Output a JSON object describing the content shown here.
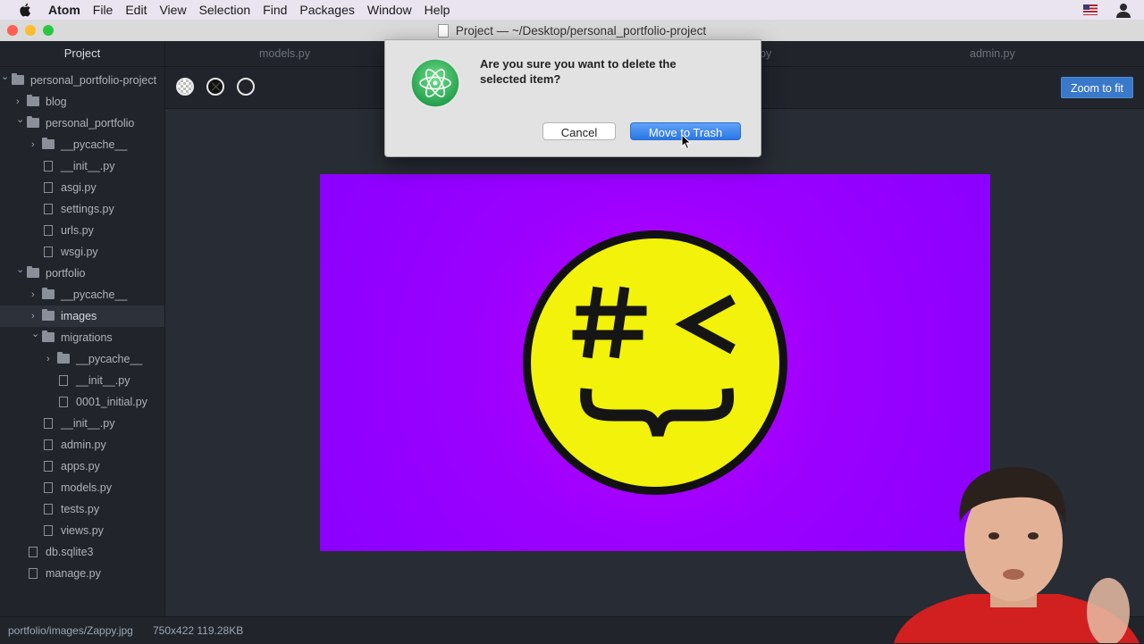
{
  "menubar": {
    "app": "Atom",
    "items": [
      "File",
      "Edit",
      "View",
      "Selection",
      "Find",
      "Packages",
      "Window",
      "Help"
    ]
  },
  "window": {
    "title": "Project — ~/Desktop/personal_portfolio-project"
  },
  "sidebar": {
    "header": "Project",
    "tree": [
      {
        "label": "personal_portfolio-project",
        "type": "folder",
        "depth": 0,
        "expanded": true
      },
      {
        "label": "blog",
        "type": "folder",
        "depth": 1,
        "expanded": false
      },
      {
        "label": "personal_portfolio",
        "type": "folder",
        "depth": 1,
        "expanded": true
      },
      {
        "label": "__pycache__",
        "type": "folder",
        "depth": 2,
        "expanded": false
      },
      {
        "label": "__init__.py",
        "type": "file",
        "depth": 2
      },
      {
        "label": "asgi.py",
        "type": "file",
        "depth": 2
      },
      {
        "label": "settings.py",
        "type": "file",
        "depth": 2
      },
      {
        "label": "urls.py",
        "type": "file",
        "depth": 2
      },
      {
        "label": "wsgi.py",
        "type": "file",
        "depth": 2
      },
      {
        "label": "portfolio",
        "type": "folder",
        "depth": 1,
        "expanded": true
      },
      {
        "label": "__pycache__",
        "type": "folder",
        "depth": 2,
        "expanded": false
      },
      {
        "label": "images",
        "type": "folder",
        "depth": 2,
        "expanded": false,
        "selected": true
      },
      {
        "label": "migrations",
        "type": "folder",
        "depth": 2,
        "expanded": true
      },
      {
        "label": "__pycache__",
        "type": "folder",
        "depth": 3,
        "expanded": false
      },
      {
        "label": "__init__.py",
        "type": "file",
        "depth": 3
      },
      {
        "label": "0001_initial.py",
        "type": "file",
        "depth": 3
      },
      {
        "label": "__init__.py",
        "type": "file",
        "depth": 2
      },
      {
        "label": "admin.py",
        "type": "file",
        "depth": 2
      },
      {
        "label": "apps.py",
        "type": "file",
        "depth": 2
      },
      {
        "label": "models.py",
        "type": "file",
        "depth": 2
      },
      {
        "label": "tests.py",
        "type": "file",
        "depth": 2
      },
      {
        "label": "views.py",
        "type": "file",
        "depth": 2
      },
      {
        "label": "db.sqlite3",
        "type": "file",
        "depth": 1
      },
      {
        "label": "manage.py",
        "type": "file",
        "depth": 1
      }
    ]
  },
  "tabs": [
    {
      "label": "models.py"
    },
    {
      "label": "py"
    },
    {
      "label": "admin.py"
    }
  ],
  "editor": {
    "zoom_label": "Zoom to fit"
  },
  "dialog": {
    "message": "Are you sure you want to delete the selected item?",
    "cancel_label": "Cancel",
    "confirm_label": "Move to Trash"
  },
  "statusbar": {
    "path": "portfolio/images/Zappy.jpg",
    "meta": "750x422 119.28KB"
  },
  "colors": {
    "image_background": "#9c00ff",
    "smiley_face": "#f2f20a",
    "accent": "#3a78c9"
  }
}
